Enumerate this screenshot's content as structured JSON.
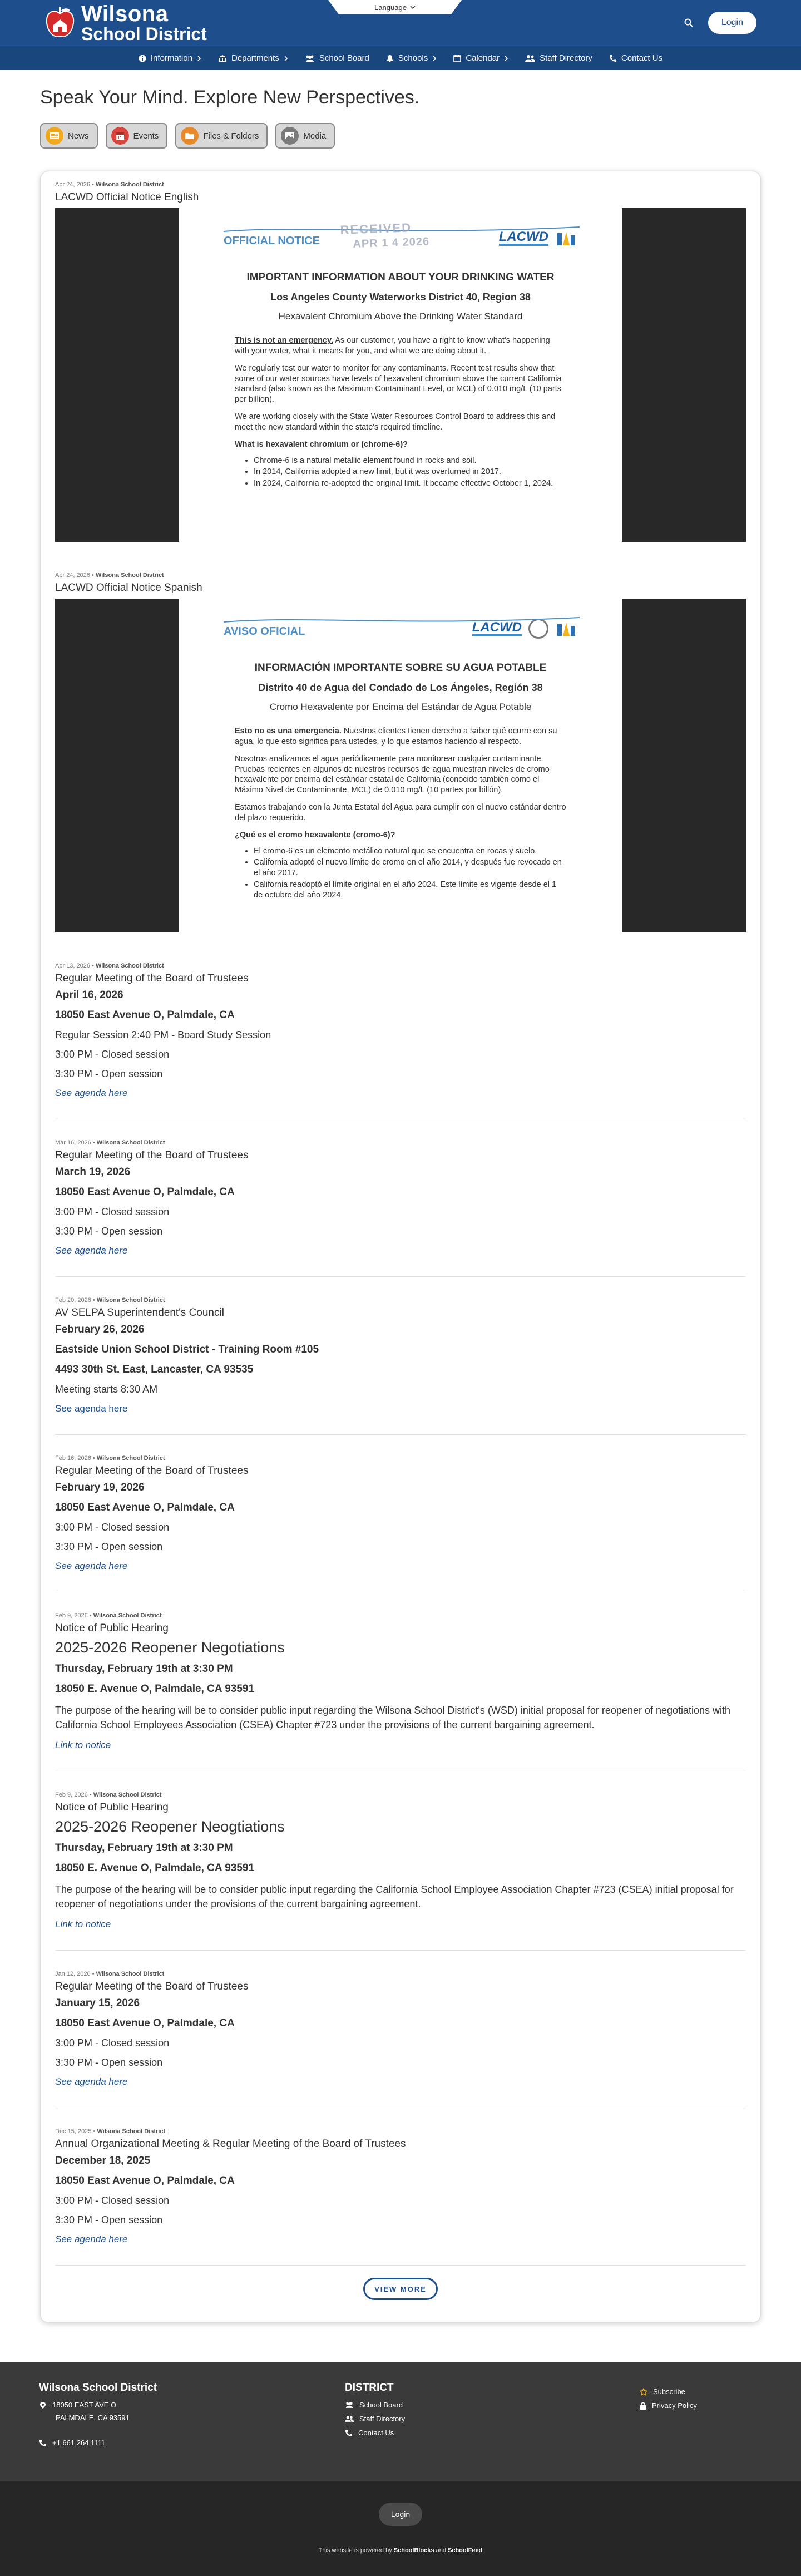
{
  "header": {
    "logo_line1": "Wilsona",
    "logo_line2": "School District",
    "language_label": "Language",
    "login_label": "Login"
  },
  "nav": [
    {
      "label": "Information",
      "icon": "info-icon",
      "has_chevron": true
    },
    {
      "label": "Departments",
      "icon": "building-icon",
      "has_chevron": true
    },
    {
      "label": "School Board",
      "icon": "people-icon",
      "has_chevron": false
    },
    {
      "label": "Schools",
      "icon": "bell-icon",
      "has_chevron": true
    },
    {
      "label": "Calendar",
      "icon": "calendar-icon",
      "has_chevron": true
    },
    {
      "label": "Staff Directory",
      "icon": "staff-icon",
      "has_chevron": false
    },
    {
      "label": "Contact Us",
      "icon": "phone-icon",
      "has_chevron": false
    }
  ],
  "hero": {
    "tagline": "Speak Your Mind. Explore New Perspectives.",
    "filters": [
      {
        "label": "News",
        "color": "#f0a81e"
      },
      {
        "label": "Events",
        "color": "#d9443c"
      },
      {
        "label": "Files & Folders",
        "color": "#e8892c"
      },
      {
        "label": "Media",
        "color": "#7a7a7a"
      }
    ]
  },
  "posts": {
    "p1": {
      "date": "Apr 24, 2026",
      "source": "Wilsona School District",
      "title": "LACWD Official Notice English",
      "doc": {
        "notice_title": "OFFICIAL NOTICE",
        "stamp_line1": "RECEIVED",
        "stamp_line2": "APR 1 4 2026",
        "lacwd": "LACWD",
        "h1": "IMPORTANT INFORMATION ABOUT YOUR DRINKING WATER",
        "h2": "Los Angeles County Waterworks District 40, Region 38",
        "h3": "Hexavalent Chromium Above the Drinking Water Standard",
        "p1_u": "This is not an emergency.",
        "p1": " As our customer, you have a right to know what's happening with your water, what it means for you, and what we are doing about it.",
        "p2": "We regularly test our water to monitor for any contaminants. Recent test results show that some of our water sources have levels of hexavalent chromium above the current California standard (also known as the Maximum Contaminant Level, or MCL) of 0.010 mg/L (10 parts per billion).",
        "p3": "We are working closely with the State Water Resources Control Board to address this and meet the new standard within the state's required timeline.",
        "q": "What is hexavalent chromium or (chrome-6)?",
        "li1": "Chrome-6 is a natural metallic element found in rocks and soil.",
        "li2": "In 2014, California adopted a new limit, but it was overturned in 2017.",
        "li3": "In 2024, California re-adopted the original limit. It became effective October 1, 2024."
      }
    },
    "p2": {
      "date": "Apr 24, 2026",
      "source": "Wilsona School District",
      "title": "LACWD Official Notice Spanish",
      "doc": {
        "notice_title": "AVISO OFICIAL",
        "lacwd": "LACWD",
        "h1": "INFORMACIÓN IMPORTANTE SOBRE SU AGUA POTABLE",
        "h2": "Distrito 40 de Agua del Condado de Los Ángeles, Región 38",
        "h3": "Cromo Hexavalente por Encima del Estándar de Agua Potable",
        "p1_u": "Esto no es una emergencia.",
        "p1": " Nuestros clientes tienen derecho a saber qué ocurre con su agua, lo que esto significa para ustedes, y lo que estamos haciendo al respecto.",
        "p2": "Nosotros analizamos el agua periódicamente para monitorear cualquier contaminante. Pruebas recientes en algunos de nuestros recursos de agua muestran niveles de cromo hexavalente por encima del estándar estatal de California (conocido también como el Máximo Nivel de Contaminante, MCL) de 0.010 mg/L (10 partes por billón).",
        "p3": "Estamos trabajando con la Junta Estatal del Agua para cumplir con el nuevo estándar dentro del plazo requerido.",
        "q": "¿Qué es el cromo hexavalente (cromo-6)?",
        "li1": "El cromo-6 es un elemento metálico natural que se encuentra en rocas y suelo.",
        "li2": "California adoptó el nuevo límite de cromo en el año 2014, y después fue revocado en el año 2017.",
        "li3": "California readoptó el límite original en el año 2024. Este límite es vigente desde el 1 de octubre del año 2024."
      }
    },
    "p3": {
      "date": "Apr 13, 2026",
      "source": "Wilsona School District",
      "title": "Regular Meeting of the Board of Trustees",
      "line1": "April 16, 2026",
      "line2": "18050 East Avenue O, Palmdale, CA",
      "line3": "Regular Session 2:40 PM - Board Study Session",
      "line4": "3:00 PM - Closed session",
      "line5": "3:30 PM - Open session",
      "link": "See agenda here"
    },
    "p4": {
      "date": "Mar 16, 2026",
      "source": "Wilsona School District",
      "title": "Regular Meeting of the Board of Trustees",
      "line1": "March 19, 2026",
      "line2": "18050 East Avenue O, Palmdale, CA",
      "line3": "3:00 PM - Closed session",
      "line4": "3:30 PM - Open session",
      "link": "See agenda here"
    },
    "p5": {
      "date": "Feb 20, 2026",
      "source": "Wilsona School District",
      "title": "AV SELPA Superintendent's Council",
      "line1": "February 26, 2026",
      "line2": "Eastside Union School District - Training Room #105",
      "line3": "4493 30th St. East, Lancaster, CA 93535",
      "line4": "Meeting starts 8:30 AM",
      "link": "See agenda here"
    },
    "p6": {
      "date": "Feb 16, 2026",
      "source": "Wilsona School District",
      "title": "Regular Meeting of the Board of Trustees",
      "line1": "February 19, 2026",
      "line2": "18050 East Avenue O, Palmdale, CA",
      "line3": "3:00 PM - Closed session",
      "line4": "3:30 PM - Open session",
      "link": "See agenda here"
    },
    "p7": {
      "date": "Feb 9, 2026",
      "source": "Wilsona School District",
      "title": "Notice of Public Hearing",
      "subtitle": "2025-2026 Reopener Negotiations",
      "line1": "Thursday, February 19th at 3:30 PM",
      "line2": "18050 E. Avenue O, Palmdale, CA 93591",
      "para": "The purpose of the hearing will be to consider public input regarding the Wilsona School District's (WSD) initial proposal for reopener of negotiations with California School Employees Association (CSEA) Chapter #723 under the provisions of the current bargaining agreement.",
      "link": "Link to notice"
    },
    "p8": {
      "date": "Feb 9, 2026",
      "source": "Wilsona School District",
      "title": "Notice of Public Hearing",
      "subtitle": "2025-2026 Reopener Neogtiations",
      "line1": "Thursday, February 19th at 3:30 PM",
      "line2": "18050 E. Avenue O, Palmdale, CA 93591",
      "para": "The purpose of the hearing will be to consider public input regarding the California School Employee Association Chapter #723 (CSEA) initial proposal for reopener of negotiations under the provisions of the current bargaining agreement.",
      "link": "Link to notice"
    },
    "p9": {
      "date": "Jan 12, 2026",
      "source": "Wilsona School District",
      "title": "Regular Meeting of the Board of Trustees",
      "line1": "January 15, 2026",
      "line2": "18050 East Avenue O, Palmdale, CA",
      "line3": "3:00 PM - Closed session",
      "line4": "3:30 PM - Open session",
      "link": "See agenda here"
    },
    "p10": {
      "date": "Dec 15, 2025",
      "source": "Wilsona School District",
      "title": "Annual Organizational Meeting & Regular Meeting of the Board of Trustees",
      "line1": "December 18, 2025",
      "line2": "18050 East Avenue O, Palmdale, CA",
      "line3": "3:00 PM - Closed session",
      "line4": "3:30 PM - Open session",
      "link": "See agenda here"
    }
  },
  "view_more_label": "VIEW MORE",
  "footer": {
    "district_name": "Wilsona School District",
    "address1": "18050 EAST AVE O",
    "address2": "PALMDALE, CA 93591",
    "phone": "+1 661 264 1111",
    "district_heading": "DISTRICT",
    "links": [
      "School Board",
      "Staff Directory",
      "Contact Us"
    ],
    "subscribe": "Subscribe",
    "privacy": "Privacy Policy",
    "login_label": "Login",
    "powered_prefix": "This website is powered by ",
    "powered_brand1": "SchoolBlocks",
    "powered_and": " and ",
    "powered_brand2": "SchoolFeed"
  }
}
